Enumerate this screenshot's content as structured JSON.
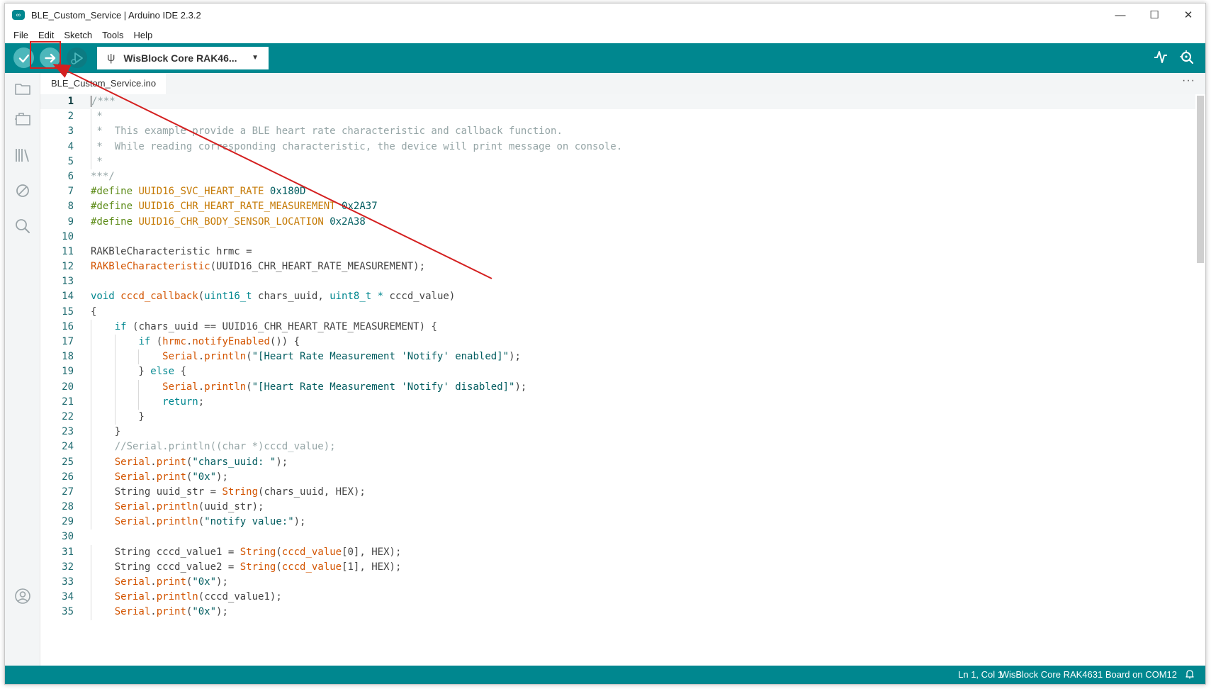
{
  "window": {
    "title": "BLE_Custom_Service | Arduino IDE 2.3.2",
    "logo_glyph": "∞",
    "controls": {
      "minimize": "—",
      "maximize": "☐",
      "close": "✕"
    }
  },
  "menu": {
    "items": [
      {
        "label": "File"
      },
      {
        "label": "Edit"
      },
      {
        "label": "Sketch"
      },
      {
        "label": "Tools"
      },
      {
        "label": "Help"
      }
    ]
  },
  "toolbar": {
    "board": "WisBlock Core RAK46...",
    "usb_glyph": "ψ",
    "caret_glyph": "▼",
    "accent_color": "#00878f",
    "icons": {
      "verify": "checkmark-icon",
      "upload": "arrow-right-icon",
      "debug": "debug-icon",
      "serial_plotter": "pulse-icon",
      "serial_monitor": "magnifier-icon"
    }
  },
  "sidebar": {
    "icons": [
      "folder-icon",
      "board-manager-icon",
      "library-icon",
      "debug-disabled-icon",
      "search-icon",
      "account-icon"
    ]
  },
  "tabs": [
    {
      "label": "BLE_Custom_Service.ino"
    }
  ],
  "tab_more": "···",
  "editor": {
    "lines": [
      {
        "n": "1",
        "t": "/***"
      },
      {
        "n": "2",
        "t": " *"
      },
      {
        "n": "3",
        "t": " *  This example provide a BLE heart rate characteristic and callback function."
      },
      {
        "n": "4",
        "t": " *  While reading corresponding characteristic, the device will print message on console."
      },
      {
        "n": "5",
        "t": " *"
      },
      {
        "n": "6",
        "t": "***/"
      },
      {
        "n": "7",
        "t": "#define UUID16_SVC_HEART_RATE 0x180D"
      },
      {
        "n": "8",
        "t": "#define UUID16_CHR_HEART_RATE_MEASUREMENT 0x2A37"
      },
      {
        "n": "9",
        "t": "#define UUID16_CHR_BODY_SENSOR_LOCATION 0x2A38"
      },
      {
        "n": "10",
        "t": ""
      },
      {
        "n": "11",
        "t": "RAKBleCharacteristic hrmc ="
      },
      {
        "n": "12",
        "t": "RAKBleCharacteristic(UUID16_CHR_HEART_RATE_MEASUREMENT);"
      },
      {
        "n": "13",
        "t": ""
      },
      {
        "n": "14",
        "t": "void cccd_callback(uint16_t chars_uuid, uint8_t * cccd_value)"
      },
      {
        "n": "15",
        "t": "{"
      },
      {
        "n": "16",
        "t": "    if (chars_uuid == UUID16_CHR_HEART_RATE_MEASUREMENT) {"
      },
      {
        "n": "17",
        "t": "        if (hrmc.notifyEnabled()) {"
      },
      {
        "n": "18",
        "t": "            Serial.println(\"[Heart Rate Measurement 'Notify' enabled]\");"
      },
      {
        "n": "19",
        "t": "        } else {"
      },
      {
        "n": "20",
        "t": "            Serial.println(\"[Heart Rate Measurement 'Notify' disabled]\");"
      },
      {
        "n": "21",
        "t": "            return;"
      },
      {
        "n": "22",
        "t": "        }"
      },
      {
        "n": "23",
        "t": "    }"
      },
      {
        "n": "24",
        "t": "    //Serial.println((char *)cccd_value);"
      },
      {
        "n": "25",
        "t": "    Serial.print(\"chars_uuid: \");"
      },
      {
        "n": "26",
        "t": "    Serial.print(\"0x\");"
      },
      {
        "n": "27",
        "t": "    String uuid_str = String(chars_uuid, HEX);"
      },
      {
        "n": "28",
        "t": "    Serial.println(uuid_str);"
      },
      {
        "n": "29",
        "t": "    Serial.println(\"notify value:\");"
      },
      {
        "n": "30",
        "t": ""
      },
      {
        "n": "31",
        "t": "    String cccd_value1 = String(cccd_value[0], HEX);"
      },
      {
        "n": "32",
        "t": "    String cccd_value2 = String(cccd_value[1], HEX);"
      },
      {
        "n": "33",
        "t": "    Serial.print(\"0x\");"
      },
      {
        "n": "34",
        "t": "    Serial.println(cccd_value1);"
      },
      {
        "n": "35",
        "t": "    Serial.print(\"0x\");"
      }
    ]
  },
  "status": {
    "position": "Ln 1, Col 1",
    "board": "WisBlock Core RAK4631 Board on COM12"
  }
}
